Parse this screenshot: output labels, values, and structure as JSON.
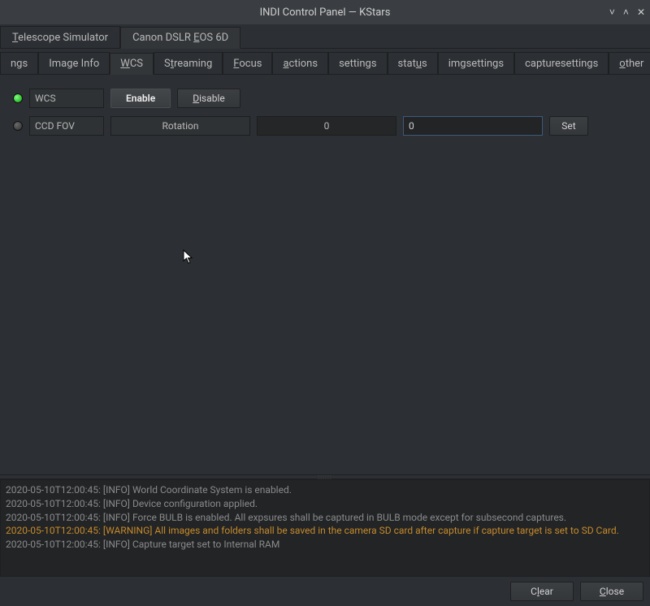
{
  "window": {
    "title": "INDI Control Panel — KStars"
  },
  "topTabs": [
    {
      "label": "Telescope Simulator",
      "active": false
    },
    {
      "label": "Canon DSLR EOS 6D",
      "active": true
    }
  ],
  "subTabs": [
    {
      "label": "ngs"
    },
    {
      "label": "Image Info"
    },
    {
      "label": "WCS",
      "active": true
    },
    {
      "label": "Streaming"
    },
    {
      "label": "Focus"
    },
    {
      "label": "actions"
    },
    {
      "label": "settings"
    },
    {
      "label": "status"
    },
    {
      "label": "imgsettings"
    },
    {
      "label": "capturesettings"
    },
    {
      "label": "other"
    }
  ],
  "wcs": {
    "row1": {
      "label": "WCS",
      "enable": "Enable",
      "disable": "Disable"
    },
    "row2": {
      "label": "CCD FOV",
      "field_label": "Rotation",
      "current": "0",
      "input": "0",
      "set": "Set"
    }
  },
  "log": [
    {
      "text": "2020-05-10T12:00:45: [INFO] World Coordinate System is enabled."
    },
    {
      "text": "2020-05-10T12:00:45: [INFO] Device configuration applied."
    },
    {
      "text": "2020-05-10T12:00:45: [INFO] Force BULB is enabled. All expsures shall be captured in BULB mode except for subsecond captures."
    },
    {
      "text": "2020-05-10T12:00:45: [WARNING] All images and folders shall be saved in the camera SD card after capture if capture target is set to SD Card.",
      "warn": true
    },
    {
      "text": "2020-05-10T12:00:45: [INFO] Capture target set to Internal RAM"
    }
  ],
  "buttons": {
    "clear": "Clear",
    "close": "Close"
  }
}
